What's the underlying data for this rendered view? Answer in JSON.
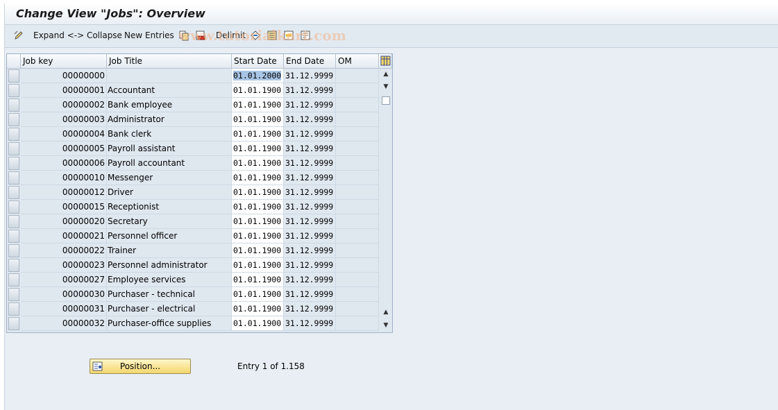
{
  "title": "Change View \"Jobs\": Overview",
  "toolbar": {
    "expand_collapse": "Expand <-> Collapse",
    "new_entries": "New Entries",
    "delimit": "Delimit"
  },
  "watermark": "www.tutorialkart.com",
  "table": {
    "headers": {
      "job_key": "Job key",
      "job_title": "Job Title",
      "start_date": "Start Date",
      "end_date": "End Date",
      "om": "OM"
    },
    "rows": [
      {
        "key": "00000000",
        "title": "",
        "start": "01.01.2000",
        "end": "31.12.9999"
      },
      {
        "key": "00000001",
        "title": "Accountant",
        "start": "01.01.1900",
        "end": "31.12.9999"
      },
      {
        "key": "00000002",
        "title": "Bank employee",
        "start": "01.01.1900",
        "end": "31.12.9999"
      },
      {
        "key": "00000003",
        "title": "Administrator",
        "start": "01.01.1900",
        "end": "31.12.9999"
      },
      {
        "key": "00000004",
        "title": "Bank clerk",
        "start": "01.01.1900",
        "end": "31.12.9999"
      },
      {
        "key": "00000005",
        "title": "Payroll assistant",
        "start": "01.01.1900",
        "end": "31.12.9999"
      },
      {
        "key": "00000006",
        "title": "Payroll accountant",
        "start": "01.01.1900",
        "end": "31.12.9999"
      },
      {
        "key": "00000010",
        "title": "Messenger",
        "start": "01.01.1900",
        "end": "31.12.9999"
      },
      {
        "key": "00000012",
        "title": "Driver",
        "start": "01.01.1900",
        "end": "31.12.9999"
      },
      {
        "key": "00000015",
        "title": "Receptionist",
        "start": "01.01.1900",
        "end": "31.12.9999"
      },
      {
        "key": "00000020",
        "title": "Secretary",
        "start": "01.01.1900",
        "end": "31.12.9999"
      },
      {
        "key": "00000021",
        "title": "Personnel officer",
        "start": "01.01.1900",
        "end": "31.12.9999"
      },
      {
        "key": "00000022",
        "title": "Trainer",
        "start": "01.01.1900",
        "end": "31.12.9999"
      },
      {
        "key": "00000023",
        "title": "Personnel administrator",
        "start": "01.01.1900",
        "end": "31.12.9999"
      },
      {
        "key": "00000027",
        "title": "Employee services",
        "start": "01.01.1900",
        "end": "31.12.9999"
      },
      {
        "key": "00000030",
        "title": "Purchaser - technical",
        "start": "01.01.1900",
        "end": "31.12.9999"
      },
      {
        "key": "00000031",
        "title": "Purchaser - electrical",
        "start": "01.01.1900",
        "end": "31.12.9999"
      },
      {
        "key": "00000032",
        "title": "Purchaser-office supplies",
        "start": "01.01.1900",
        "end": "31.12.9999"
      }
    ]
  },
  "position_button": "Position...",
  "entry_status": "Entry 1 of 1.158",
  "colors": {
    "highlight": "#a8c4e4",
    "button": "#f3d66d",
    "background": "#e8eef4"
  }
}
